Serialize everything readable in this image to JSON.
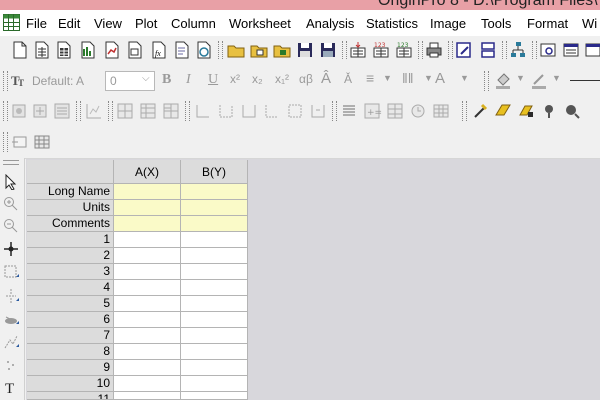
{
  "window": {
    "title": "OriginPro 8 - D:\\Program Files\\"
  },
  "menu": [
    "File",
    "Edit",
    "View",
    "Plot",
    "Column",
    "Worksheet",
    "Analysis",
    "Statistics",
    "Image",
    "Tools",
    "Format",
    "Wi"
  ],
  "format_toolbar": {
    "font_style": "Default: A",
    "font_size": "0"
  },
  "worksheet": {
    "columns": [
      "A(X)",
      "B(Y)"
    ],
    "meta_rows": [
      "Long Name",
      "Units",
      "Comments"
    ],
    "rows": [
      "1",
      "2",
      "3",
      "4",
      "5",
      "6",
      "7",
      "8",
      "9",
      "10",
      "11"
    ]
  },
  "icons": {
    "app": "origin-grid-icon"
  },
  "colors": {
    "label_row_fill": "#fafac8",
    "workspace_bg": "#d8d7dc",
    "title_bar": "#e8a0a6"
  }
}
